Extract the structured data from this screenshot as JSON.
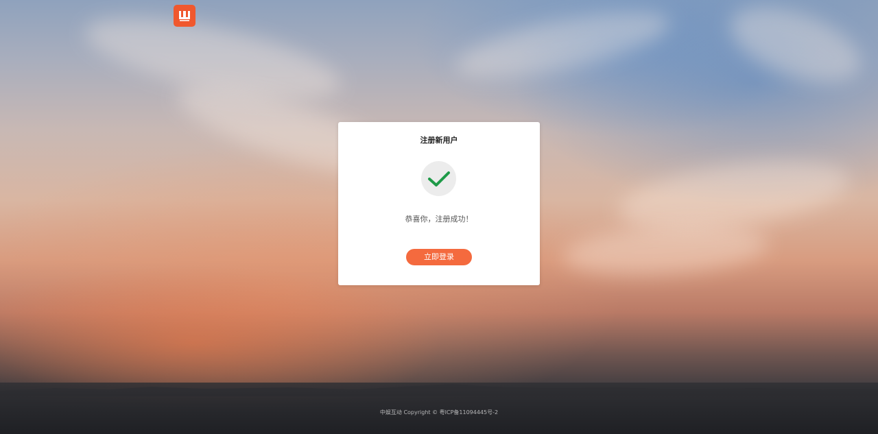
{
  "logo": {
    "icon": "brand-logo-icon",
    "color": "#f0582e"
  },
  "card": {
    "title": "注册新用户",
    "success_icon": "check-icon",
    "check_color": "#1e9a48",
    "message": "恭喜你，注册成功！",
    "login_button_label": "立即登录",
    "button_color": "#f46a3e"
  },
  "footer": {
    "text": "中娱互动 Copyright © 粤ICP备11094445号-2"
  }
}
